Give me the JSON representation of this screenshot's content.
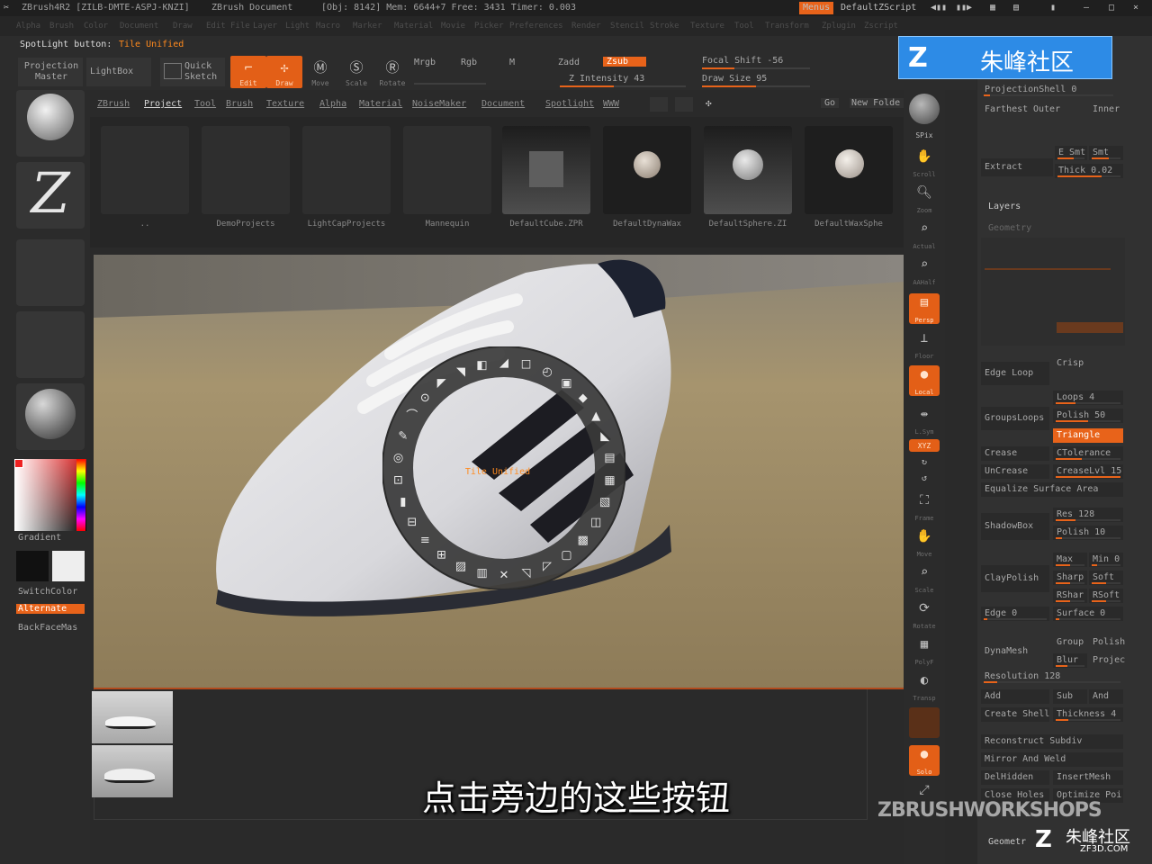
{
  "titlebar": {
    "app": "ZBrush4R2 [ZILB-DMTE-ASPJ-KNZI]",
    "doc": "ZBrush Document",
    "stats": "[Obj: 8142] Mem: 6644+7 Free: 3431 Timer: 0.003",
    "menus_btn": "Menus",
    "script": "DefaultZScript"
  },
  "menubar": [
    "Alpha",
    "Brush",
    "Color",
    "Document",
    "Draw",
    "Edit",
    "File",
    "Layer",
    "Light",
    "Macro",
    "Marker",
    "Material",
    "Movie",
    "Picker",
    "Preferences",
    "Render",
    "Stencil",
    "Stroke",
    "Texture",
    "Tool",
    "Transform",
    "Zplugin",
    "Zscript"
  ],
  "spotlight": {
    "label": "SpotLight button:",
    "value": "Tile Unified"
  },
  "toolbar": {
    "projection_master": "Projection Master",
    "lightbox": "LightBox",
    "quick_sketch": "Quick Sketch",
    "edit": "Edit",
    "draw": "Draw",
    "move": "Move",
    "scale": "Scale",
    "rotate": "Rotate",
    "mrgb": "Mrgb",
    "rgb": "Rgb",
    "m": "M",
    "zadd": "Zadd",
    "zsub": "Zsub",
    "z_intensity": "Z Intensity 43",
    "focal_shift": "Focal Shift -56",
    "draw_size": "Draw Size 95",
    "intensity_fill": 0.43,
    "draw_size_fill": 0.5
  },
  "leftshelf": {
    "gradient": "Gradient",
    "switchcolor": "SwitchColor",
    "alternate": "Alternate",
    "backfacemask": "BackFaceMas"
  },
  "tabs": [
    "ZBrush",
    "Project",
    "Tool",
    "Brush",
    "Texture",
    "Alpha",
    "Material",
    "NoiseMaker",
    "Document",
    "Spotlight",
    "WWW"
  ],
  "tab_active": "Project",
  "tab_buttons": {
    "go": "Go",
    "new_folder": "New Folde"
  },
  "files": [
    "..",
    "DemoProjects",
    "LightCapProjects",
    "Mannequin",
    "DefaultCube.ZPR",
    "DefaultDynaWax",
    "DefaultSphere.ZI",
    "DefaultWaxSphe"
  ],
  "ring_label": "Tile Unified",
  "rightshelf": [
    "SPix",
    "Scroll",
    "Zoom",
    "Actual",
    "AAHalf",
    "Persp",
    "Floor",
    "Local",
    "L.Sym",
    "XYZ",
    "",
    "",
    "Frame",
    "Move",
    "Scale",
    "Rotate",
    "PolyF",
    "Transp",
    "",
    "Solo"
  ],
  "panel": {
    "projection_shell": "ProjectionShell 0",
    "farthest": "Farthest",
    "outer": "Outer",
    "inner": "Inner",
    "extract": "Extract",
    "e_smt": "E Smt 5",
    "s_smt": "Smt",
    "thick": "Thick 0.02",
    "layers": "Layers",
    "geometry_hd": "Geometry",
    "edge_loop": "Edge Loop",
    "crisp": "Crisp",
    "group_loops": "GroupsLoops",
    "loops": "Loops 4",
    "polish_50": "Polish 50",
    "triangle": "Triangle",
    "crease": "Crease",
    "ctolerance": "CTolerance",
    "uncrease": "UnCrease",
    "crease_lvl": "CreaseLvl 15",
    "equalize": "Equalize Surface Area",
    "shadowbox": "ShadowBox",
    "res": "Res 128",
    "polish_10": "Polish 10",
    "clay_polish": "ClayPolish",
    "max": "Max",
    "min": "Min 0",
    "sharp": "Sharp",
    "soft": "Soft",
    "rshar": "RShar",
    "rsoft": "RSoft",
    "edge0": "Edge 0",
    "surface0": "Surface 0",
    "dynamesh": "DynaMesh",
    "group": "Group",
    "polish": "Polish",
    "blur": "Blur",
    "projec": "Projec",
    "resolution": "Resolution 128",
    "add": "Add",
    "sub": "Sub",
    "and": "And",
    "create_shell": "Create Shell",
    "thickness": "Thickness 4",
    "reconstruct": "Reconstruct Subdiv",
    "mirror_weld": "Mirror And Weld",
    "delhidden": "DelHidden",
    "insertmesh": "InsertMesh",
    "close_holes": "Close Holes",
    "optimize": "Optimize Poi",
    "geometry_hd2": "Geometr"
  },
  "subtitle": "点击旁边的这些按钮",
  "watermark": {
    "site": "朱峰社区",
    "brand": "ZBRUSHWORKSHOPS",
    "domain": "ZF3D.COM"
  },
  "colors": {
    "accent": "#e8631a",
    "bg": "#2a2a2a",
    "watermark_blue": "#2d8be6"
  }
}
